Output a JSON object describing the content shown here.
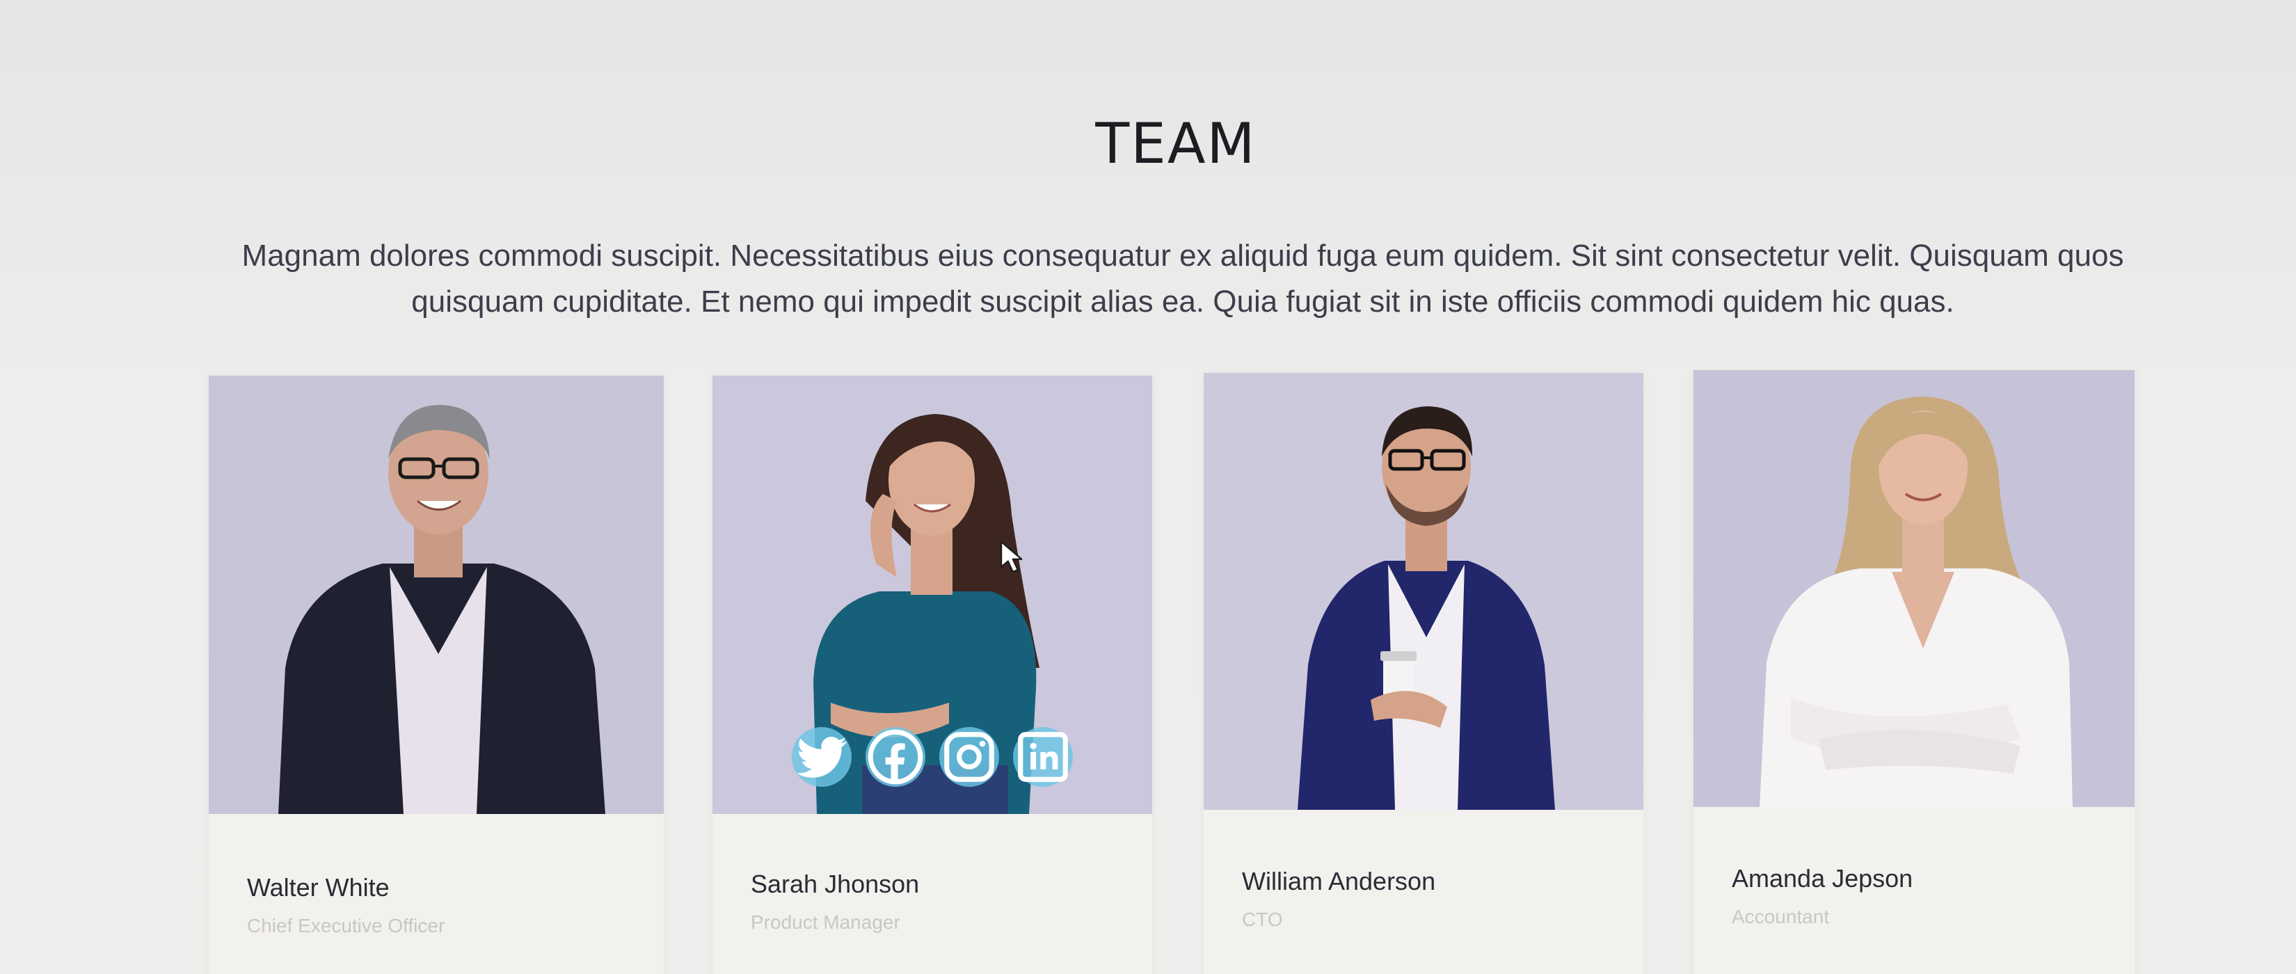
{
  "section": {
    "title": "TEAM",
    "description": "Magnam dolores commodi suscipit. Necessitatibus eius consequatur ex aliquid fuga eum quidem. Sit sint consectetur velit. Quisquam quos quisquam cupiditate. Et nemo qui impedit suscipit alias ea. Quia fugiat sit in iste officiis commodi quidem hic quas."
  },
  "team": [
    {
      "name": "Walter White",
      "role": "Chief Executive Officer"
    },
    {
      "name": "Sarah Jhonson",
      "role": "Product Manager"
    },
    {
      "name": "William Anderson",
      "role": "CTO"
    },
    {
      "name": "Amanda Jepson",
      "role": "Accountant"
    }
  ],
  "socials": [
    {
      "icon": "twitter-icon"
    },
    {
      "icon": "facebook-icon"
    },
    {
      "icon": "instagram-icon"
    },
    {
      "icon": "linkedin-icon"
    }
  ],
  "colors": {
    "photo_background": "#c7c3d6",
    "social_button": "#6cc6e4",
    "card_background": "#f2f1ed",
    "title_text": "#1c1d22"
  }
}
